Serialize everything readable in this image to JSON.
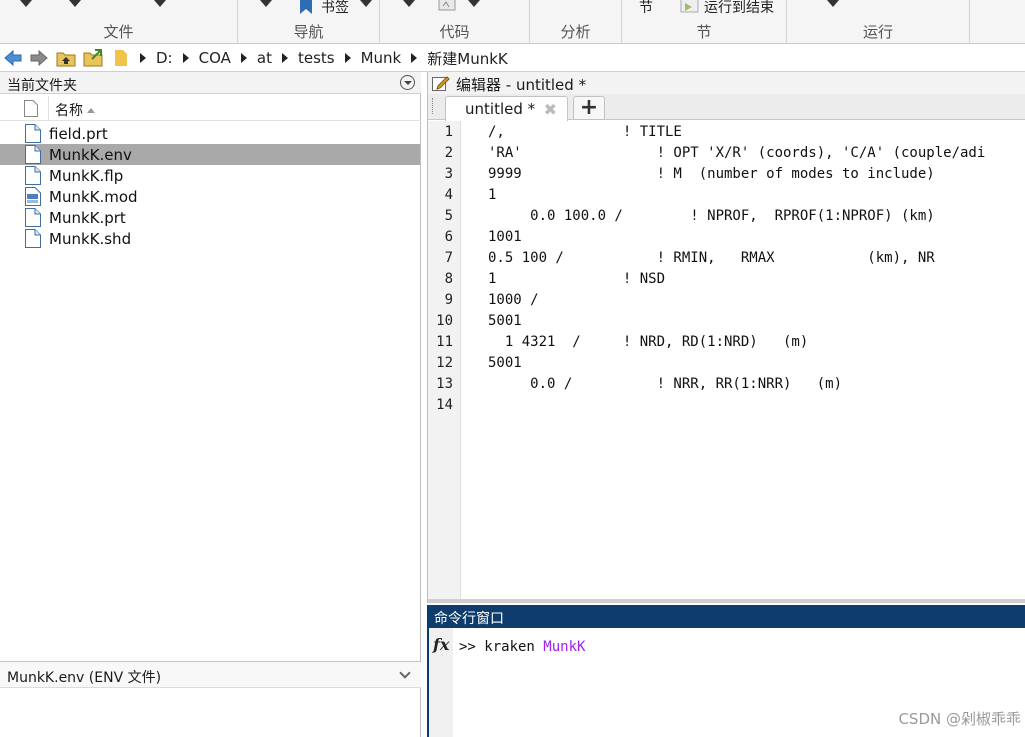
{
  "toolstrip": {
    "sections": [
      {
        "label": "文件"
      },
      {
        "label": "导航",
        "bookmark_label": "书签"
      },
      {
        "label": "代码"
      },
      {
        "label": "分析"
      },
      {
        "label": "节",
        "top_text": "节",
        "run_to_end": "运行到结束"
      },
      {
        "label": "运行"
      }
    ]
  },
  "address": {
    "path": [
      "D:",
      "COA",
      "at",
      "tests",
      "Munk",
      "新建MunkK"
    ]
  },
  "current_folder": {
    "title": "当前文件夹",
    "column_name": "名称",
    "files": [
      {
        "name": "field.prt",
        "icon": "text-file-icon"
      },
      {
        "name": "MunkK.env",
        "icon": "text-file-icon"
      },
      {
        "name": "MunkK.flp",
        "icon": "text-file-icon"
      },
      {
        "name": "MunkK.mod",
        "icon": "data-file-icon"
      },
      {
        "name": "MunkK.prt",
        "icon": "text-file-icon"
      },
      {
        "name": "MunkK.shd",
        "icon": "text-file-icon"
      }
    ],
    "selected_file": "MunkK.env",
    "details": "MunkK.env  (ENV 文件)"
  },
  "editor": {
    "title": "编辑器 - untitled *",
    "tab_label": "untitled *",
    "add_tab": "+",
    "lines": [
      {
        "n": "1",
        "text": "/,              ! TITLE"
      },
      {
        "n": "2",
        "text": "'RA'                ! OPT 'X/R' (coords), 'C/A' (couple/adi"
      },
      {
        "n": "3",
        "text": "9999                ! M  (number of modes to include)"
      },
      {
        "n": "4",
        "text": "1"
      },
      {
        "n": "5",
        "text": "     0.0 100.0 /        ! NPROF,  RPROF(1:NPROF) (km)"
      },
      {
        "n": "6",
        "text": "1001"
      },
      {
        "n": "7",
        "text": "0.5 100 /           ! RMIN,   RMAX           (km), NR"
      },
      {
        "n": "8",
        "text": "1               ! NSD"
      },
      {
        "n": "9",
        "text": "1000 /"
      },
      {
        "n": "10",
        "text": "5001"
      },
      {
        "n": "11",
        "text": "  1 4321  /     ! NRD, RD(1:NRD)   (m)"
      },
      {
        "n": "12",
        "text": "5001"
      },
      {
        "n": "13",
        "text": "     0.0 /          ! NRR, RR(1:NRR)   (m)"
      },
      {
        "n": "14",
        "text": ""
      }
    ]
  },
  "command_window": {
    "title": "命令行窗口",
    "fx": "fx",
    "prompt": ">> kraken ",
    "argument": "MunkK"
  },
  "watermark": "CSDN @剁椒乖乖",
  "colors": {
    "command_title_bg": "#0e3d6d",
    "selected_row_bg": "#a9a9a9",
    "command_argument": "#a020f0"
  }
}
